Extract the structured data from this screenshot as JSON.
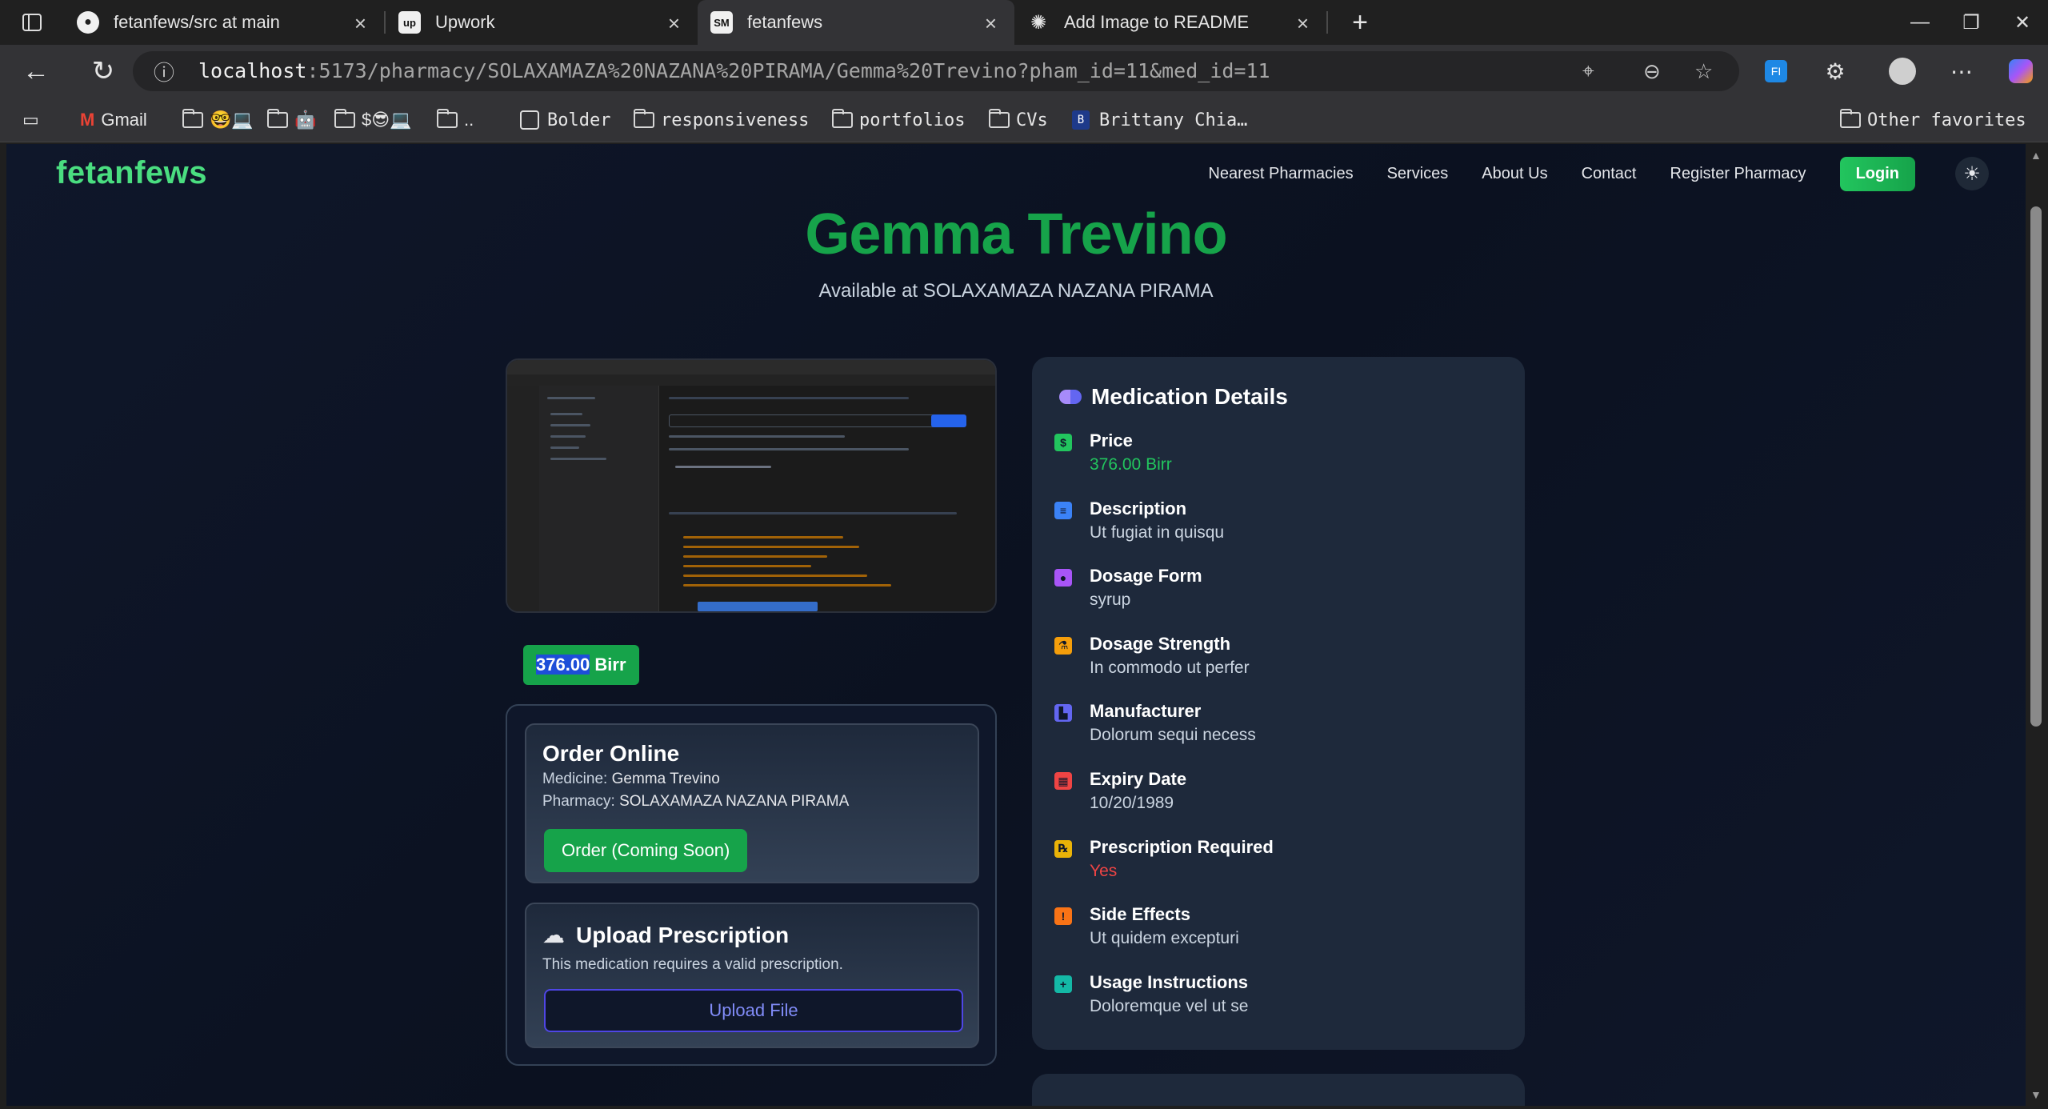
{
  "browser": {
    "tabs": [
      {
        "label": "fetanfews/src at main",
        "icon": "github-icon"
      },
      {
        "label": "Upwork",
        "icon": "upwork-icon"
      },
      {
        "label": "fetanfews",
        "icon": "sm-icon",
        "favicon_text": "SM"
      },
      {
        "label": "Add Image to README",
        "icon": "openai-icon"
      }
    ],
    "url_host": "localhost",
    "url_rest": ":5173/pharmacy/SOLAXAMAZA%20NAZANA%20PIRAMA/Gemma%20Trevino?pham_id=11&med_id=11",
    "bookmarks": [
      "Gmail",
      "🤓💻",
      "🤖",
      "$😎💻",
      "..",
      "Bolder",
      "responsiveness",
      "portfolios",
      "CVs",
      "Brittany Chia…"
    ],
    "bookmark_badge": "B",
    "other_favorites": "Other favorites"
  },
  "site": {
    "brand": "fetanfews",
    "nav": [
      "Nearest Pharmacies",
      "Services",
      "About Us",
      "Contact",
      "Register Pharmacy"
    ],
    "login": "Login"
  },
  "medicine": {
    "name": "Gemma Trevino",
    "available_at": "Available at SOLAXAMAZA NAZANA PIRAMA",
    "price_number": "376.00",
    "price_unit": " Birr"
  },
  "order": {
    "title": "Order Online",
    "medicine_label": "Medicine: ",
    "medicine_value": "Gemma Trevino",
    "pharmacy_label": "Pharmacy: ",
    "pharmacy_value": "SOLAXAMAZA NAZANA PIRAMA",
    "button": "Order (Coming Soon)"
  },
  "upload": {
    "title": "Upload Prescription",
    "text": "This medication requires a valid prescription.",
    "button": "Upload File"
  },
  "details": {
    "title": "Medication Details",
    "rows": [
      {
        "label": "Price",
        "value": "376.00 Birr",
        "icon": "money-icon",
        "color": "#22c55e",
        "value_color": "#22c55e"
      },
      {
        "label": "Description",
        "value": "Ut fugiat in quisqu",
        "icon": "description-icon",
        "color": "#3b82f6"
      },
      {
        "label": "Dosage Form",
        "value": "syrup",
        "icon": "pills-icon",
        "color": "#a855f7"
      },
      {
        "label": "Dosage Strength",
        "value": "In commodo ut perfer",
        "icon": "flask-icon",
        "color": "#f59e0b"
      },
      {
        "label": "Manufacturer",
        "value": "Dolorum sequi necess",
        "icon": "factory-icon",
        "color": "#6366f1"
      },
      {
        "label": "Expiry Date",
        "value": "10/20/1989",
        "icon": "calendar-icon",
        "color": "#ef4444"
      },
      {
        "label": "Prescription Required",
        "value": "Yes",
        "icon": "prescription-icon",
        "color": "#eab308",
        "value_color": "#ef4444"
      },
      {
        "label": "Side Effects",
        "value": "Ut quidem excepturi",
        "icon": "warning-icon",
        "color": "#f97316"
      },
      {
        "label": "Usage Instructions",
        "value": "Doloremque vel ut se",
        "icon": "medkit-icon",
        "color": "#14b8a6"
      }
    ]
  }
}
